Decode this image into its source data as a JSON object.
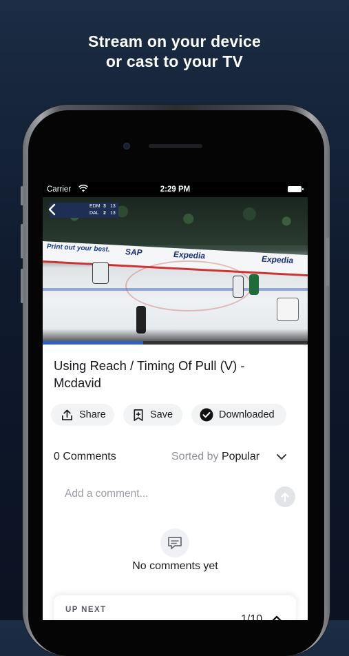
{
  "headline": {
    "line1": "Stream on your device",
    "line2": "or cast to your TV"
  },
  "status_bar": {
    "carrier": "Carrier",
    "time": "2:29 PM",
    "icons": [
      "wifi-icon",
      "battery-icon"
    ]
  },
  "video": {
    "scoreboard": {
      "team1": "EDM",
      "score1": "3",
      "team2": "DAL",
      "score2": "2",
      "shots1": "13",
      "shots2": "13"
    },
    "board_ads": [
      "Print out your best.",
      "SAP",
      "Expedia",
      "Expedia"
    ],
    "progress": 0.38
  },
  "content": {
    "title": "Using Reach / Timing Of Pull (V) - Mcdavid",
    "actions": [
      {
        "label": "Share",
        "icon": "share-icon"
      },
      {
        "label": "Save",
        "icon": "bookmark-icon"
      },
      {
        "label": "Downloaded",
        "icon": "check-circle-icon"
      }
    ]
  },
  "comments": {
    "count_label": "0 Comments",
    "sorted_by_label": "Sorted by",
    "sort_value": "Popular",
    "input_placeholder": "Add a comment...",
    "empty_text": "No comments yet"
  },
  "up_next": {
    "label": "UP NEXT",
    "count": "1/10"
  },
  "colors": {
    "background": "#0f1a2d",
    "accent_blue": "#2f5fc0",
    "chip_bg": "#f2f3f5"
  }
}
